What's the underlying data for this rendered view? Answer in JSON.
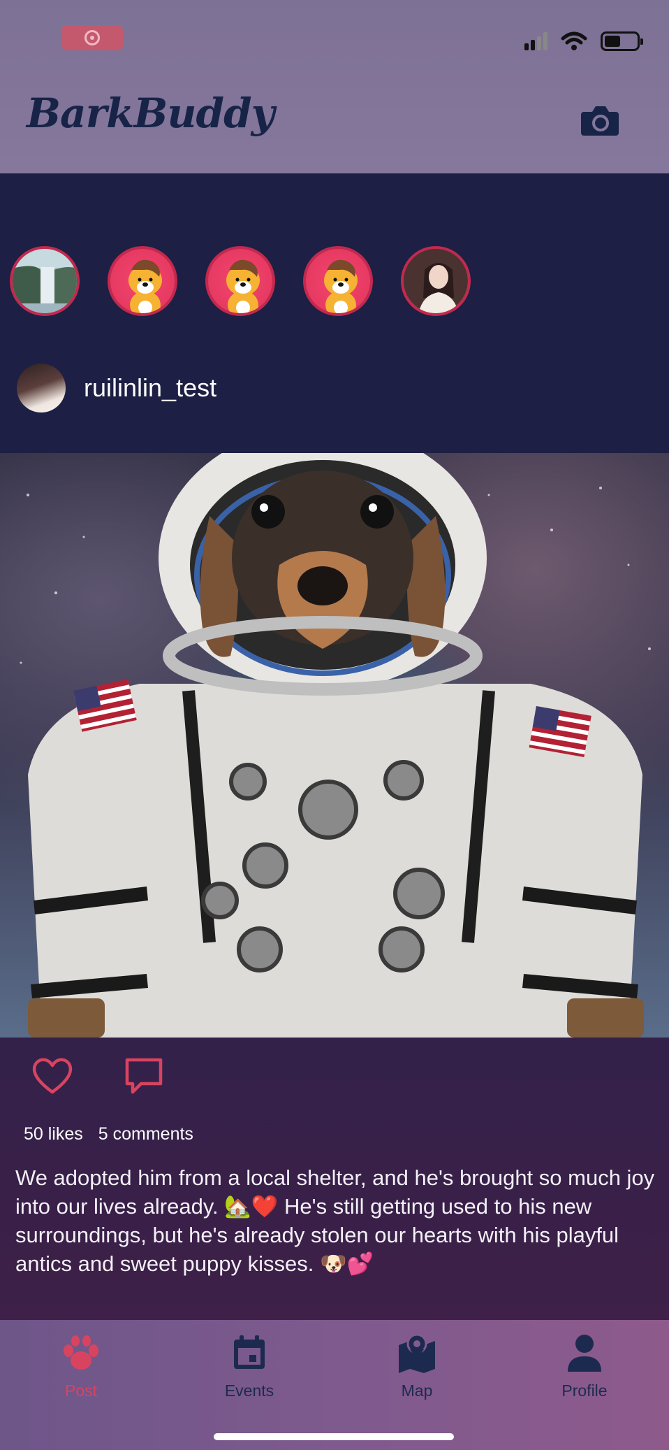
{
  "app": {
    "brand": "BarkBuddy"
  },
  "status_bar": {
    "battery_level": 0.5
  },
  "header": {
    "camera_icon": "camera-icon"
  },
  "stories": [
    {
      "name": "story-waterfall",
      "kind": "photo"
    },
    {
      "name": "story-dog-1",
      "kind": "dog-avatar"
    },
    {
      "name": "story-dog-2",
      "kind": "dog-avatar"
    },
    {
      "name": "story-dog-3",
      "kind": "dog-avatar"
    },
    {
      "name": "story-woman",
      "kind": "photo"
    }
  ],
  "post": {
    "author": "ruilinlin_test",
    "likes": "50 likes",
    "comments": "5 comments",
    "caption": "We adopted him from a local shelter, and he's brought so much joy into our lives already. 🏡❤️ He's still getting used to his new surroundings, but he's already stolen our hearts with his playful antics and sweet puppy kisses. 🐶💕"
  },
  "bottom_nav": [
    {
      "label": "Post",
      "icon": "paw-icon",
      "active": true
    },
    {
      "label": "Events",
      "icon": "calendar-icon",
      "active": false
    },
    {
      "label": "Map",
      "icon": "map-icon",
      "active": false
    },
    {
      "label": "Profile",
      "icon": "person-icon",
      "active": false
    }
  ],
  "colors": {
    "accent": "#d8445f",
    "header_bg": "#84779b",
    "feed_bg": "#1d1f44",
    "nav_text": "#1d2a4f"
  }
}
